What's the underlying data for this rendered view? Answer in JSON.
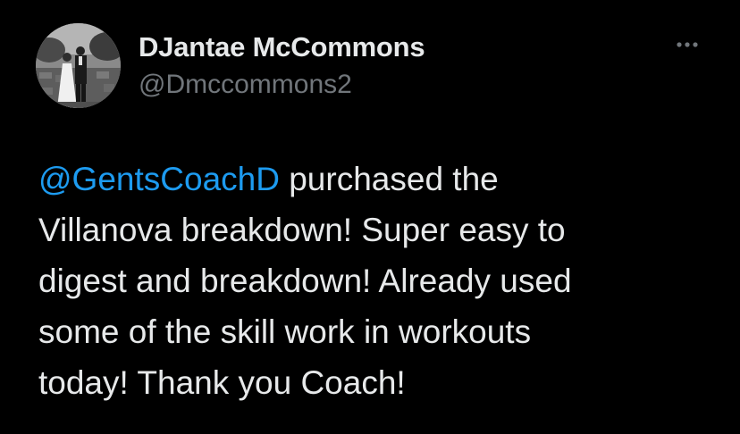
{
  "author": {
    "display_name": "DJantae McCommons",
    "handle": "@Dmccommons2",
    "avatar_icon": "wedding-photo-avatar"
  },
  "more_icon": "more-horizontal-icon",
  "tweet": {
    "mention": "@GentsCoachD",
    "lines": [
      " purchased the",
      "Villanova breakdown! Super easy to",
      "digest and breakdown! Already used",
      "some of the skill work in workouts",
      "today! Thank you Coach!"
    ]
  },
  "colors": {
    "background": "#000000",
    "text": "#e7e9ea",
    "secondary": "#71767b",
    "link": "#1d9bf0"
  }
}
